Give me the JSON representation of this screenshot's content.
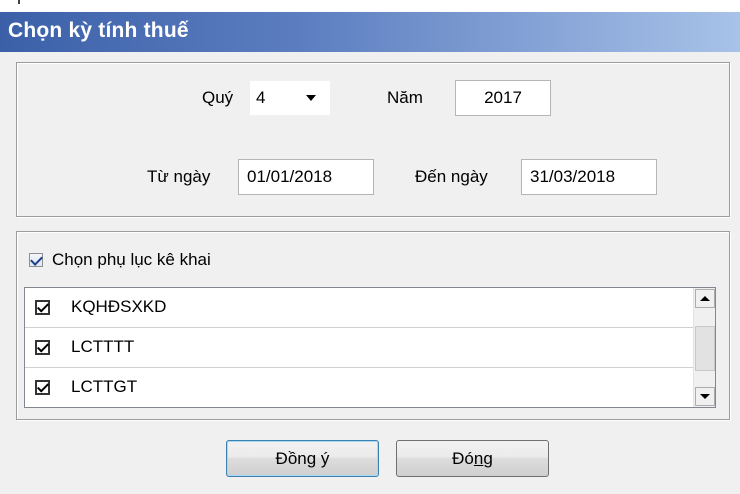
{
  "dialog": {
    "title": "Chọn kỳ tính thuế"
  },
  "period": {
    "quarter_label": "Quý",
    "quarter_value": "4",
    "year_label": "Năm",
    "year_value": "2017",
    "from_label": "Từ ngày",
    "from_value": "01/01/2018",
    "to_label": "Đến ngày",
    "to_value": "31/03/2018"
  },
  "annex": {
    "select_label": "Chọn phụ lục kê khai",
    "select_checked": true,
    "items": [
      {
        "label": "KQHĐSXKD",
        "checked": true
      },
      {
        "label": "LCTTTT",
        "checked": true
      },
      {
        "label": "LCTTGT",
        "checked": true
      }
    ]
  },
  "buttons": {
    "ok_prefix": "Đồn",
    "ok_mnemonic": "g",
    "ok_suffix": " ý",
    "close_prefix": "Đó",
    "close_mnemonic": "n",
    "close_suffix": "g"
  },
  "colors": {
    "title_gradient_start": "#3c60a8",
    "title_gradient_end": "#a8c2e8",
    "dialog_background": "#f0f0f0"
  }
}
